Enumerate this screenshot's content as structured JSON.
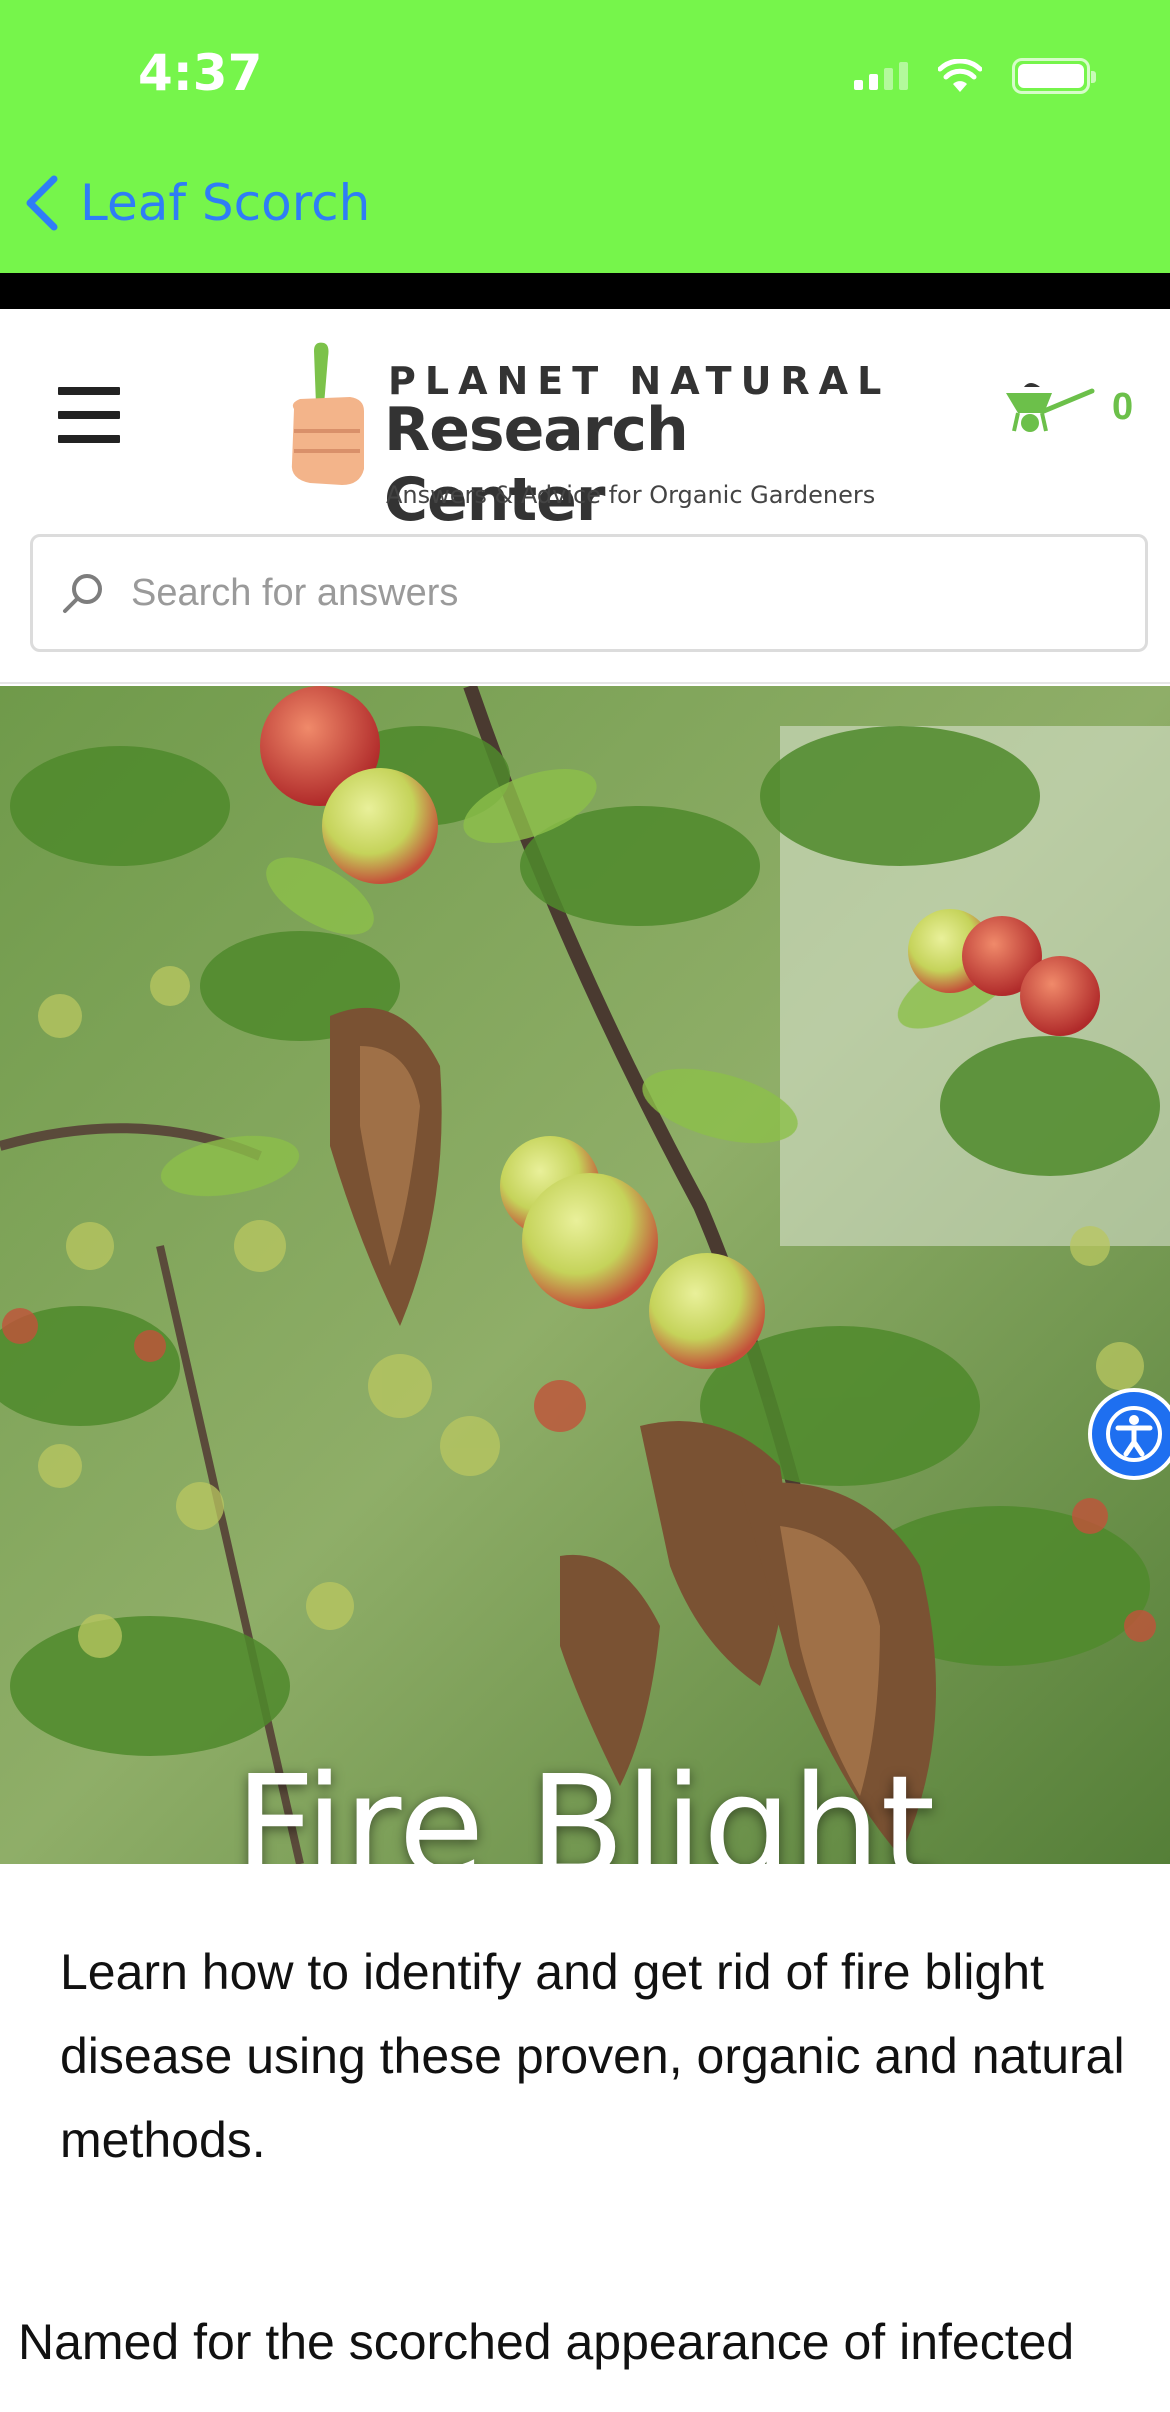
{
  "status_bar": {
    "time": "4:37"
  },
  "nav": {
    "back_label": "Leaf Scorch"
  },
  "header": {
    "logo_line1": "PLANET NATURAL",
    "logo_line2": "Research Center",
    "logo_tagline": "Answers & Advice for Organic Gardeners",
    "cart_count": "0"
  },
  "search": {
    "placeholder": "Search for answers",
    "value": ""
  },
  "hero": {
    "title": "Fire Blight"
  },
  "article": {
    "intro": "Learn how to identify and get rid of fire blight disease using these proven, organic and natural methods.",
    "body": "Named for the scorched appearance of infected"
  },
  "colors": {
    "topbar": "#76f54b",
    "back_link": "#2f7df6",
    "cart": "#6cc04a",
    "accessibility": "#1e6ff0"
  }
}
